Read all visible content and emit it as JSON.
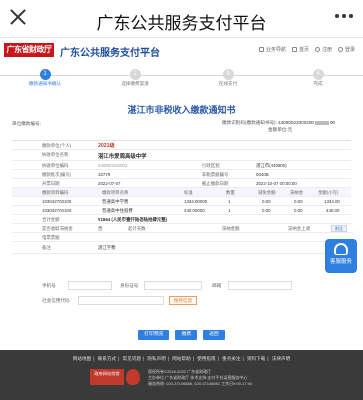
{
  "window": {
    "title": "广东公共服务支付平台"
  },
  "header": {
    "logo_text": "广东省财政厅",
    "site_name": "广东公共服务支付平台",
    "links": [
      "业务导航",
      "首页",
      "注册",
      "登录"
    ]
  },
  "steps": [
    {
      "num": "1",
      "label": "缴款通知书确认"
    },
    {
      "num": "2",
      "label": "选择缴费渠道"
    },
    {
      "num": "3",
      "label": "在线支付"
    },
    {
      "num": "4",
      "label": "完成"
    }
  ],
  "notice": {
    "title": "湛江市非税收入缴款通知书",
    "unit_label": "单位缴款编号:",
    "notice_no_label": "缴款识别码(缴款通知书号):",
    "notice_no_value": "44080022000200",
    "notice_no_suffix": "00",
    "amount_label": "金额单位:元"
  },
  "form": {
    "payer_type_label": "缴款单位(个人)",
    "payer_value": "2021级",
    "receiver_label": "执收单位名称",
    "receiver_value": "湛江市爱周高级中学",
    "receiver_code_label": "执收单位编码",
    "receiver_code_value": "440800102003",
    "region_label": "行政区划",
    "region_value": "湛江市(440800)",
    "approval_label": "缴款批次(编号)",
    "approval_value": "32779",
    "doc_type_label": "非税票据编号",
    "doc_type_value": "0040B",
    "issue_date_label": "开票日期",
    "issue_date_value": "2022-07-07",
    "due_date_label": "截止缴款日期",
    "due_date_value": "2022-10-07 00:00:00",
    "columns": [
      "缴款项目编码",
      "缴款项目名称",
      "标准",
      "数量",
      "减免金额",
      "滞纳金",
      "金额(小写)"
    ],
    "items": [
      {
        "code": "103042703100",
        "name": "普通高中学费",
        "std": "1334.00000",
        "qty": "1",
        "reduce": "0.00",
        "late": "0.00",
        "amount": "1334.00"
      },
      {
        "code": "103042704100",
        "name": "普通高中住宿费",
        "std": "440.00000",
        "qty": "1",
        "reduce": "0.00",
        "late": "0.00",
        "amount": "440.00"
      }
    ],
    "total_label": "合计金额",
    "total_value": "¥1664 (人民币壹仟陆佰陆拾肆元整)",
    "late_fee_label": "是否收取滞纳金",
    "late_fee_value": "否",
    "late_start_label": "起计天数",
    "late_amount_label": "滞纳金额",
    "late_fee_rate_label": "滞纳金上调",
    "remark_button": "附注",
    "invoice_type_label": "电票票据",
    "notes_label": "备注",
    "notes_value": "湛江学费"
  },
  "float_service": {
    "label": "客服服务"
  },
  "extra": {
    "phone_label": "手机号",
    "id_label": "身份证号",
    "email_label": "邮箱",
    "credit_code_label": "社会信用代码",
    "save_button": "保存信息"
  },
  "actions": {
    "print": "打印预览",
    "pay": "缴费",
    "back": "返回"
  },
  "footer": {
    "links": [
      "网站地图",
      "联系方式",
      "常见问题",
      "隐私声明",
      "网站帮助",
      "使用指南",
      "重点关注",
      "资料下载",
      "法律声明"
    ],
    "badge_text": "政府网站找错",
    "info_line1": "版权所有©2016-2022 广东省财政厅",
    "info_line2": "主办单位:广东省财政厅 技术支持:支付平台运营服务中心",
    "info_line3": "服务热线: 020-37146866, 020-37146851 工作日9:00-17:00"
  }
}
